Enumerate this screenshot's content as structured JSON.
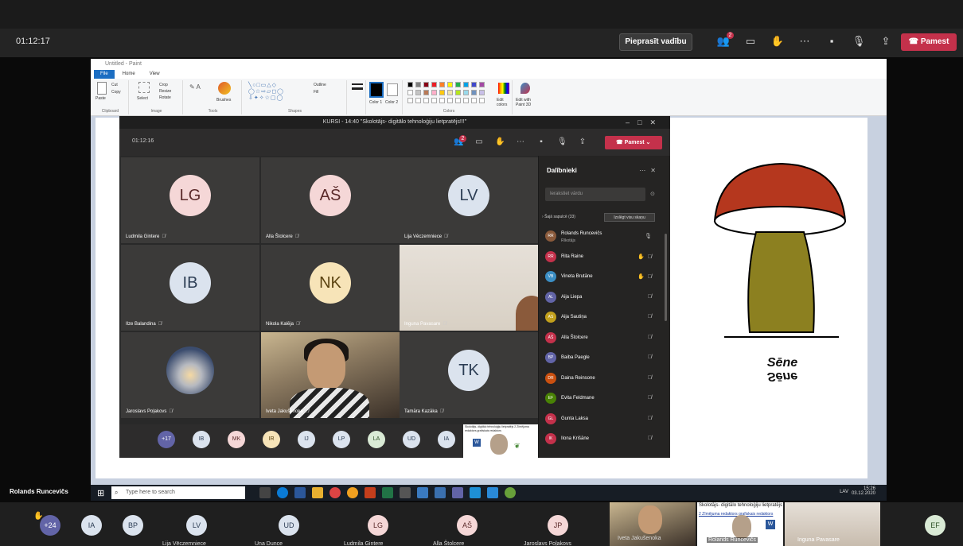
{
  "outer_bar": {
    "time": "01:12:17",
    "request_control": "Pieprasīt vadību",
    "leave": "Pamest",
    "icons": [
      "participants-icon",
      "chat-icon",
      "raise-hand-icon",
      "more-icon",
      "camera-off-icon",
      "mic-off-icon",
      "share-icon"
    ]
  },
  "paint": {
    "title": "Untitled - Paint",
    "tabs": [
      "File",
      "Home",
      "View"
    ],
    "ribbon": {
      "clipboard": {
        "label": "Clipboard",
        "paste": "Paste",
        "cut": "Cut",
        "copy": "Copy"
      },
      "image": {
        "label": "Image",
        "select": "Select",
        "crop": "Crop",
        "resize": "Resize",
        "rotate": "Rotate"
      },
      "tools": {
        "label": "Tools",
        "brushes": "Brushes"
      },
      "shapes": {
        "label": "Shapes",
        "outline": "Outline",
        "fill": "Fill"
      },
      "size": "Size",
      "color1": "Color 1",
      "color2": "Color 2",
      "colors_label": "Colors",
      "edit_colors": "Edit colors",
      "edit_paint3d": "Edit with Paint 3D"
    },
    "canvas_text": "Sēne"
  },
  "inner": {
    "title": "KURSI - 14:40 \"Skolotājs- digitālo tehnoloģiju lietpratējs!!!\"",
    "time": "01:12:16",
    "leave": "Pamest",
    "tiles": [
      {
        "initials": "LG",
        "name": "Ludmila Gintere",
        "bg": "#f5d7d7",
        "fg": "#5b2a2a"
      },
      {
        "initials": "AŠ",
        "name": "Alla Štolcere",
        "bg": "#f5d7d7",
        "fg": "#5b2a2a"
      },
      {
        "initials": "LV",
        "name": "Lija Vēczemniece",
        "bg": "#dbe3ee",
        "fg": "#2c3d54"
      },
      {
        "initials": "IB",
        "name": "Ilze Balandina",
        "bg": "#dbe3ee",
        "fg": "#2c3d54"
      },
      {
        "initials": "NK",
        "name": "Nikola Kalēja",
        "bg": "#f7e4b8",
        "fg": "#5c4412"
      },
      {
        "initials": "",
        "name": "Inguna Pavasare",
        "bg": "",
        "fg": ""
      },
      {
        "initials": "",
        "name": "Jaroslavs Poļakovs",
        "bg": "",
        "fg": ""
      },
      {
        "initials": "",
        "name": "Iveta Jakušenoka",
        "bg": "",
        "fg": ""
      },
      {
        "initials": "TK",
        "name": "Tamāra Kazāka",
        "bg": "#dbe3ee",
        "fg": "#2c3d54"
      }
    ],
    "strip": [
      {
        "initials": "+17",
        "bg": "#6264a7",
        "fg": "#fff"
      },
      {
        "initials": "IB",
        "bg": "#dbe3ee",
        "fg": "#2c3d54"
      },
      {
        "initials": "MK",
        "bg": "#f5d7d7",
        "fg": "#5b2a2a"
      },
      {
        "initials": "IR",
        "bg": "#f7e4b8",
        "fg": "#5c4412"
      },
      {
        "initials": "IJ",
        "bg": "#dbe3ee",
        "fg": "#2c3d54"
      },
      {
        "initials": "LP",
        "bg": "#dbe3ee",
        "fg": "#2c3d54"
      },
      {
        "initials": "LA",
        "bg": "#d9ead5",
        "fg": "#2f5228"
      },
      {
        "initials": "UD",
        "bg": "#dbe3ee",
        "fg": "#2c3d54"
      },
      {
        "initials": "IA",
        "bg": "#dbe3ee",
        "fg": "#2c3d54"
      }
    ],
    "share_thumb_text": "Skolotājs- digitālo tehnoloģiju lietpratējs 2 Zīmējuma redaktors grafiskais redaktors"
  },
  "participants": {
    "title": "Dalībnieki",
    "search_placeholder": "Ierakstiet vārdu",
    "section": "Šajā sapulcē (33)",
    "mute_all": "Izslēgt visu skaņu",
    "list": [
      {
        "initials": "RR",
        "name": "Rolands Runcevičs",
        "role": "Rīkotājs",
        "color": "#8a5a3b",
        "end": "mic"
      },
      {
        "initials": "RR",
        "name": "Rita Raine",
        "role": "",
        "color": "#c4314b",
        "end": "hand"
      },
      {
        "initials": "VB",
        "name": "Vineta Brutāne",
        "role": "",
        "color": "#3b8ec4",
        "end": "hand"
      },
      {
        "initials": "AL",
        "name": "Aija Liepa",
        "role": "",
        "color": "#6264a7",
        "end": "mute"
      },
      {
        "initials": "AS",
        "name": "Aija Sautiņa",
        "role": "",
        "color": "#c2a01c",
        "end": "mute"
      },
      {
        "initials": "AŠ",
        "name": "Alla Štolcere",
        "role": "",
        "color": "#c4314b",
        "end": "mute"
      },
      {
        "initials": "BP",
        "name": "Baiba Paegle",
        "role": "",
        "color": "#6264a7",
        "end": "mute"
      },
      {
        "initials": "DR",
        "name": "Daina Reinsone",
        "role": "",
        "color": "#ca5010",
        "end": "mute"
      },
      {
        "initials": "EF",
        "name": "Evita Feldmane",
        "role": "",
        "color": "#498205",
        "end": "mute"
      },
      {
        "initials": "GL",
        "name": "Gunta Laksa",
        "role": "",
        "color": "#c4314b",
        "end": "mute"
      },
      {
        "initials": "IK",
        "name": "Ilona Krišāne",
        "role": "",
        "color": "#c4314b",
        "end": "mute"
      }
    ]
  },
  "taskbar": {
    "search_placeholder": "Type here to search",
    "lang": "LAV",
    "time": "15:26",
    "date": "03.12.2020"
  },
  "presenter_name": "Rolands Runcevičs",
  "bottom": {
    "avatars": [
      {
        "initials": "+24",
        "bg": "#6264a7",
        "fg": "#fff",
        "name": ""
      },
      {
        "initials": "IA",
        "bg": "#dbe3ee",
        "fg": "#2c3d54",
        "name": ""
      },
      {
        "initials": "BP",
        "bg": "#dbe3ee",
        "fg": "#2c3d54",
        "name": ""
      },
      {
        "initials": "LV",
        "bg": "#dbe3ee",
        "fg": "#2c3d54",
        "name": "Lija Vēczemniece"
      },
      {
        "initials": "UD",
        "bg": "#dbe3ee",
        "fg": "#2c3d54",
        "name": "Una Dunce"
      },
      {
        "initials": "LG",
        "bg": "#f5d7d7",
        "fg": "#5b2a2a",
        "name": "Ludmila Gintere"
      },
      {
        "initials": "AŠ",
        "bg": "#f5d7d7",
        "fg": "#5b2a2a",
        "name": "Alla Štolcere"
      },
      {
        "initials": "JP",
        "bg": "#f5d7d7",
        "fg": "#5b2a2a",
        "name": "Jaroslavs Poļakovs"
      },
      {
        "initials": "EF",
        "bg": "#d9ead5",
        "fg": "#2f5228",
        "name": ""
      }
    ],
    "video_names": [
      "Iveta Jakušenoka",
      "Rolands Runcevičs",
      "Inguna Pavasare"
    ],
    "share_title": "Skolotājs- digitālo tehnoloģiju lietpratējs",
    "share_sub": "2 Zīmējuma redaktors grafiskais redaktors"
  }
}
